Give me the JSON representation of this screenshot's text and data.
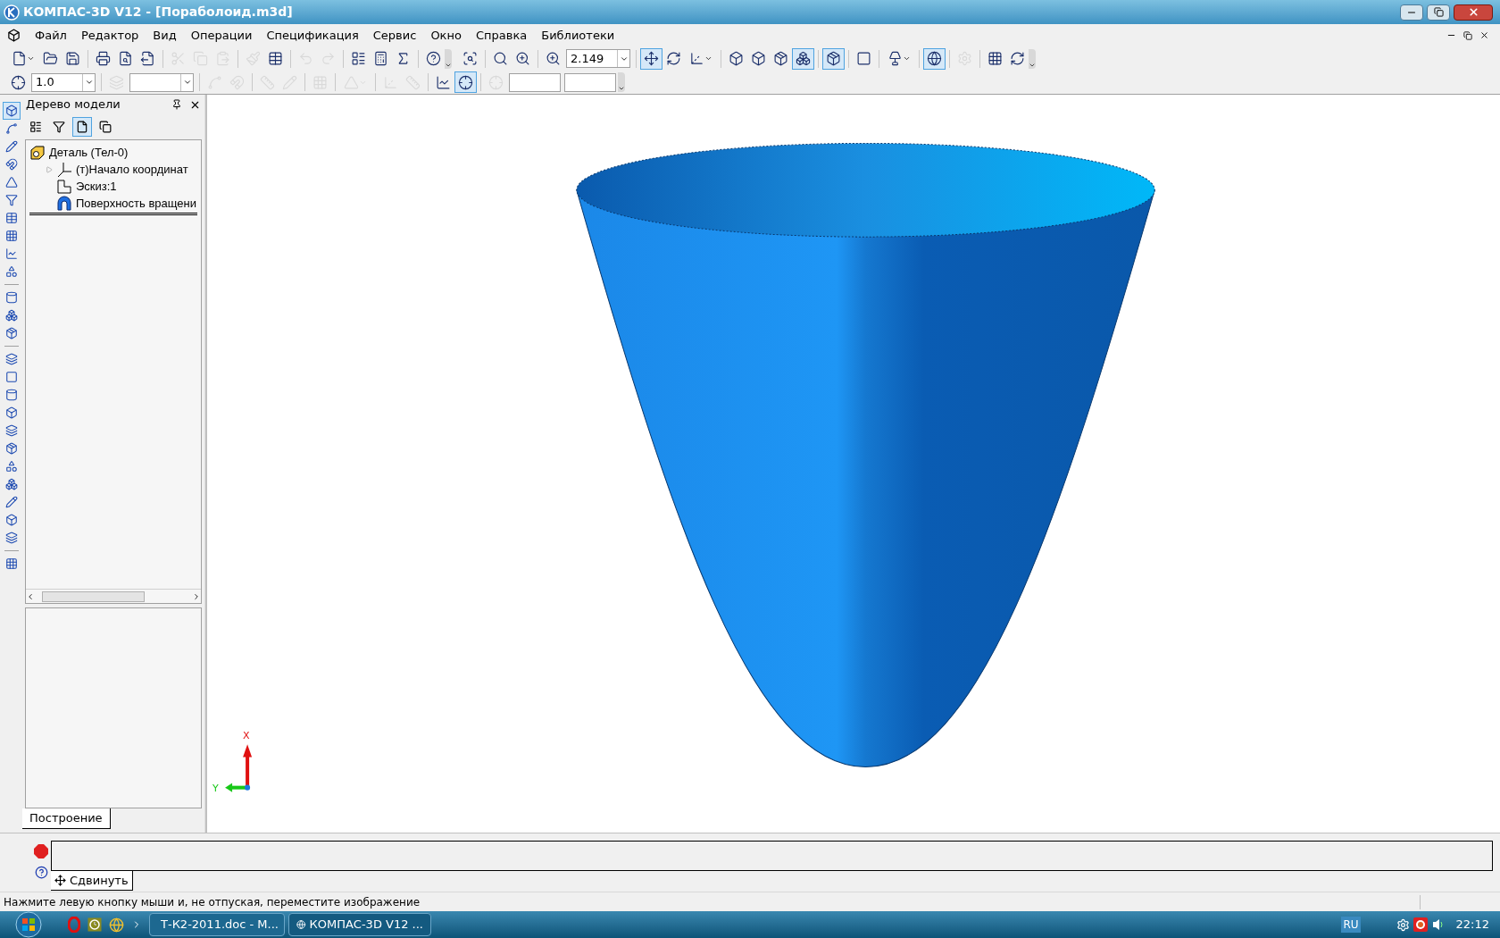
{
  "window": {
    "title": "КОМПАС-3D V12 - [Пораболоид.m3d]"
  },
  "menu": [
    "Файл",
    "Редактор",
    "Вид",
    "Операции",
    "Спецификация",
    "Сервис",
    "Окно",
    "Справка",
    "Библиотеки"
  ],
  "toolbar_1": [
    {
      "kind": "split",
      "disabled": false,
      "pressed": false
    },
    {
      "kind": "button",
      "disabled": false,
      "pressed": false
    },
    {
      "kind": "button",
      "disabled": false,
      "pressed": false
    },
    {
      "kind": "separator"
    },
    {
      "kind": "button",
      "disabled": false,
      "pressed": false
    },
    {
      "kind": "button",
      "disabled": false,
      "pressed": false
    },
    {
      "kind": "button",
      "disabled": false,
      "pressed": false
    },
    {
      "kind": "separator"
    },
    {
      "kind": "button",
      "disabled": true,
      "pressed": false
    },
    {
      "kind": "button",
      "disabled": true,
      "pressed": false
    },
    {
      "kind": "button",
      "disabled": true,
      "pressed": false
    },
    {
      "kind": "separator"
    },
    {
      "kind": "button",
      "disabled": true,
      "pressed": false
    },
    {
      "kind": "button",
      "disabled": false,
      "pressed": false
    },
    {
      "kind": "separator"
    },
    {
      "kind": "button",
      "disabled": true,
      "pressed": false
    },
    {
      "kind": "button",
      "disabled": true,
      "pressed": false
    },
    {
      "kind": "separator"
    },
    {
      "kind": "button",
      "disabled": false,
      "pressed": false
    },
    {
      "kind": "button",
      "disabled": false,
      "pressed": false
    },
    {
      "kind": "button",
      "disabled": false,
      "pressed": false
    },
    {
      "kind": "separator"
    },
    {
      "kind": "button",
      "disabled": false,
      "pressed": false
    },
    {
      "kind": "grip"
    },
    {
      "kind": "button",
      "disabled": false,
      "pressed": false
    },
    {
      "kind": "separator"
    },
    {
      "kind": "button",
      "disabled": false,
      "pressed": false
    },
    {
      "kind": "button",
      "disabled": false,
      "pressed": false
    },
    {
      "kind": "separator"
    },
    {
      "kind": "button",
      "disabled": false,
      "pressed": false
    },
    {
      "kind": "combo",
      "value": "2.149"
    },
    {
      "kind": "separator"
    },
    {
      "kind": "button",
      "disabled": false,
      "pressed": true
    },
    {
      "kind": "button",
      "disabled": false,
      "pressed": false
    },
    {
      "kind": "split",
      "disabled": false,
      "pressed": false
    },
    {
      "kind": "separator"
    },
    {
      "kind": "button",
      "disabled": false,
      "pressed": false
    },
    {
      "kind": "button",
      "disabled": false,
      "pressed": false
    },
    {
      "kind": "button",
      "disabled": false,
      "pressed": false
    },
    {
      "kind": "button",
      "disabled": false,
      "pressed": true
    },
    {
      "kind": "separator"
    },
    {
      "kind": "button",
      "disabled": false,
      "pressed": true
    },
    {
      "kind": "separator"
    },
    {
      "kind": "button",
      "disabled": false,
      "pressed": false
    },
    {
      "kind": "separator"
    },
    {
      "kind": "split",
      "disabled": false,
      "pressed": false
    },
    {
      "kind": "separator"
    },
    {
      "kind": "button",
      "disabled": false,
      "pressed": true
    },
    {
      "kind": "separator"
    },
    {
      "kind": "button",
      "disabled": true,
      "pressed": false
    },
    {
      "kind": "separator"
    },
    {
      "kind": "button",
      "disabled": false,
      "pressed": false
    },
    {
      "kind": "button",
      "disabled": false,
      "pressed": false
    },
    {
      "kind": "grip"
    }
  ],
  "toolbar_2": [
    {
      "kind": "button",
      "disabled": false,
      "pressed": false
    },
    {
      "kind": "combo",
      "value": "1.0"
    },
    {
      "kind": "separator"
    },
    {
      "kind": "button",
      "disabled": true,
      "pressed": false
    },
    {
      "kind": "combo"
    },
    {
      "kind": "separator"
    },
    {
      "kind": "button",
      "disabled": true,
      "pressed": false
    },
    {
      "kind": "button",
      "disabled": true,
      "pressed": false
    },
    {
      "kind": "separator"
    },
    {
      "kind": "button",
      "disabled": true,
      "pressed": false
    },
    {
      "kind": "button",
      "disabled": true,
      "pressed": false
    },
    {
      "kind": "separator"
    },
    {
      "kind": "button",
      "disabled": true,
      "pressed": false
    },
    {
      "kind": "separator"
    },
    {
      "kind": "split",
      "disabled": true,
      "pressed": false
    },
    {
      "kind": "separator"
    },
    {
      "kind": "button",
      "disabled": true,
      "pressed": false
    },
    {
      "kind": "button",
      "disabled": true,
      "pressed": false
    },
    {
      "kind": "separator"
    },
    {
      "kind": "button",
      "disabled": false,
      "pressed": false
    },
    {
      "kind": "button",
      "disabled": false,
      "pressed": true
    },
    {
      "kind": "separator"
    },
    {
      "kind": "button",
      "disabled": true,
      "pressed": false
    },
    {
      "kind": "field"
    },
    {
      "kind": "field"
    },
    {
      "kind": "grip"
    }
  ],
  "left_toolbar": [
    {
      "kind": "button",
      "pressed": true
    },
    {
      "kind": "button",
      "pressed": false
    },
    {
      "kind": "button",
      "pressed": false
    },
    {
      "kind": "button",
      "pressed": false
    },
    {
      "kind": "button",
      "pressed": false
    },
    {
      "kind": "button",
      "pressed": false
    },
    {
      "kind": "button",
      "pressed": false
    },
    {
      "kind": "button",
      "pressed": false
    },
    {
      "kind": "button",
      "pressed": false
    },
    {
      "kind": "button",
      "pressed": false
    },
    {
      "kind": "separator"
    },
    {
      "kind": "button",
      "pressed": false
    },
    {
      "kind": "button",
      "pressed": false
    },
    {
      "kind": "button",
      "pressed": false
    },
    {
      "kind": "separator"
    },
    {
      "kind": "button",
      "pressed": false
    },
    {
      "kind": "button",
      "pressed": false
    },
    {
      "kind": "button",
      "pressed": false
    },
    {
      "kind": "button",
      "pressed": false
    },
    {
      "kind": "button",
      "pressed": false
    },
    {
      "kind": "button",
      "pressed": false
    },
    {
      "kind": "button",
      "pressed": false
    },
    {
      "kind": "button",
      "pressed": false
    },
    {
      "kind": "button",
      "pressed": false
    },
    {
      "kind": "button",
      "pressed": false
    },
    {
      "kind": "button",
      "pressed": false
    },
    {
      "kind": "separator"
    },
    {
      "kind": "button",
      "pressed": false
    }
  ],
  "tree_panel": {
    "title": "Дерево модели",
    "toolbar": [
      {
        "pressed": false
      },
      {
        "pressed": false
      },
      {
        "pressed": true
      },
      {
        "pressed": false
      }
    ],
    "nodes": [
      {
        "kind": "part",
        "label": "Деталь (Тел-0)",
        "children": [
          {
            "kind": "origin",
            "label": "(т)Начало координат",
            "has_children": true
          },
          {
            "kind": "sketch",
            "label": "Эскиз:1",
            "has_children": false
          },
          {
            "kind": "surface",
            "label": "Поверхность вращени",
            "has_children": false
          }
        ]
      }
    ],
    "tabs": [
      {
        "label": "Построение",
        "selected": true
      }
    ]
  },
  "viewport": {
    "axes": {
      "x_label": "X",
      "y_label": "Y"
    }
  },
  "command_panel": {
    "tabs": [
      {
        "label": "Сдвинуть",
        "selected": true
      }
    ]
  },
  "status_bar": "Нажмите левую кнопку мыши и, не отпуская, переместите изображение",
  "taskbar": {
    "tasks": [
      "Т-К2-2011.doc - M...",
      "КОМПАС-3D V12 ..."
    ],
    "language": "RU",
    "clock": "22:12"
  }
}
